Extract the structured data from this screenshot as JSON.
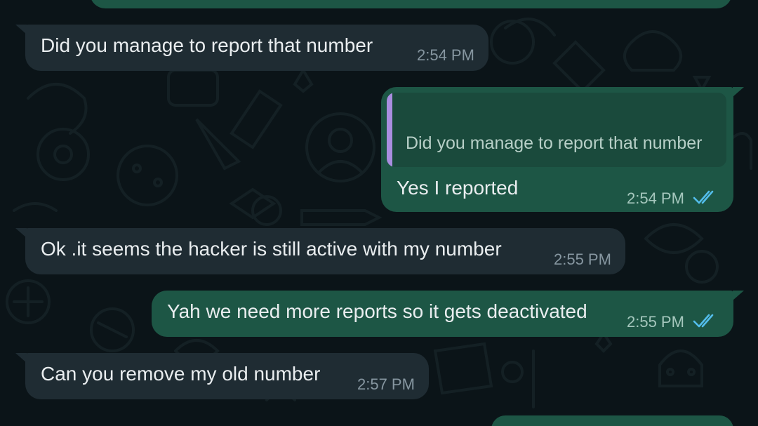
{
  "colors": {
    "background": "#0b1418",
    "incoming_bubble": "#1f2c33",
    "outgoing_bubble": "#1d5645",
    "quote_bar": "#a98ee0",
    "read_ticks": "#53bdeb"
  },
  "messages": [
    {
      "direction": "incoming",
      "text": "Did you manage to report that number",
      "time": "2:54 PM"
    },
    {
      "direction": "outgoing",
      "reply_to": "Did you manage to report that number",
      "text": "Yes I reported",
      "time": "2:54 PM",
      "status": "read-double-tick-icon"
    },
    {
      "direction": "incoming",
      "text": "Ok .it seems the hacker is still active with my number",
      "time": "2:55 PM"
    },
    {
      "direction": "outgoing",
      "text": "Yah we need more reports so it gets deactivated",
      "time": "2:55 PM",
      "status": "read-double-tick-icon"
    },
    {
      "direction": "incoming",
      "text": "Can you remove my old number",
      "time": "2:57 PM"
    }
  ]
}
